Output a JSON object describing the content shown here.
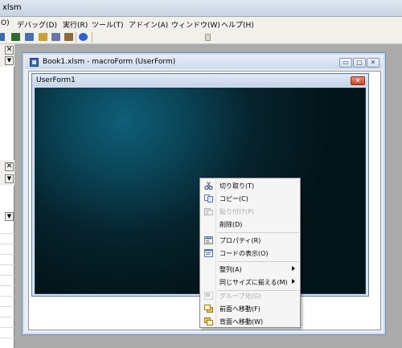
{
  "app": {
    "title": "xlsm"
  },
  "menu": [
    {
      "label": "O)"
    },
    {
      "label": "デバッグ(D)"
    },
    {
      "label": "実行(R)"
    },
    {
      "label": "ツール(T)"
    },
    {
      "label": "アドイン(A)"
    },
    {
      "label": "ウィンドウ(W)"
    },
    {
      "label": "ヘルプ(H)"
    }
  ],
  "left_pane": {
    "close_glyph": "✕",
    "drop_glyph": "▼"
  },
  "macro_window": {
    "title": "Book1.xlsm - macroForm (UserForm)",
    "min_glyph": "▭",
    "max_glyph": "□",
    "close_glyph": "✕"
  },
  "userform": {
    "title": "UserForm1",
    "close_glyph": "✕"
  },
  "context_menu": {
    "items": [
      {
        "label": "切り取り(T)",
        "icon": "scissors-icon",
        "disabled": false
      },
      {
        "label": "コピー(C)",
        "icon": "copy-icon",
        "disabled": false
      },
      {
        "label": "貼り付け(P)",
        "icon": "paste-icon",
        "disabled": true
      },
      {
        "label": "削除(D)",
        "icon": "",
        "disabled": false
      },
      {
        "label": "プロパティ(R)",
        "icon": "properties-icon",
        "disabled": false
      },
      {
        "label": "コードの表示(O)",
        "icon": "view-code-icon",
        "disabled": false
      },
      {
        "label": "整列(A)",
        "icon": "",
        "disabled": false,
        "submenu": true
      },
      {
        "label": "同じサイズに揃える(M)",
        "icon": "",
        "disabled": false,
        "submenu": true
      },
      {
        "label": "グループ化(G)",
        "icon": "group-icon",
        "disabled": true
      },
      {
        "label": "前面へ移動(F)",
        "icon": "bring-to-front-icon",
        "disabled": false
      },
      {
        "label": "背面へ移動(W)",
        "icon": "send-to-back-icon",
        "disabled": false
      }
    ]
  },
  "colors": {
    "form_background": "#06232d",
    "form_glow": "#0f5f78",
    "menu_background": "#f5f5f5",
    "caption_close": "#c8422a"
  }
}
